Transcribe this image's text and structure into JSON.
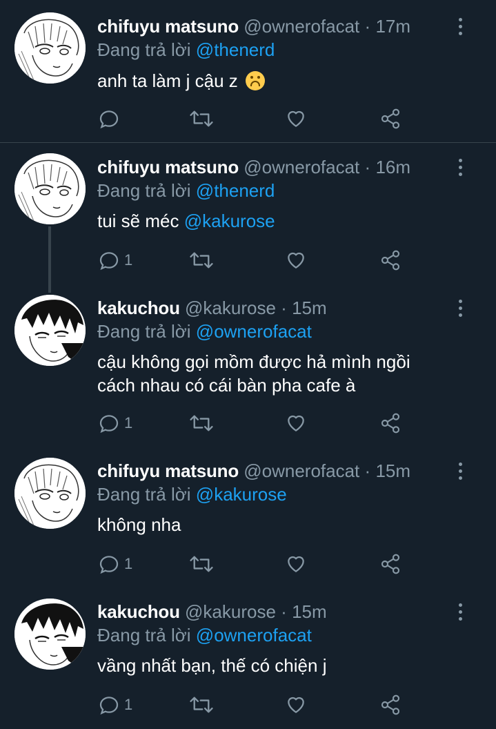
{
  "tweets": [
    {
      "name": "chifuyu matsuno",
      "handle": "@ownerofacat",
      "dot": "·",
      "time": "17m",
      "reply_prefix": "Đang trả lời",
      "reply_to": "@thenerd",
      "text": "anh ta làm j cậu z",
      "emoji": "upside-down-face-emoji",
      "replies": "",
      "avatar": "chifuyu-avatar"
    },
    {
      "name": "chifuyu matsuno",
      "handle": "@ownerofacat",
      "dot": "·",
      "time": "16m",
      "reply_prefix": "Đang trả lời",
      "reply_to": "@thenerd",
      "text": "tui sẽ méc",
      "text_mention": "@kakurose",
      "replies": "1",
      "avatar": "chifuyu-avatar"
    },
    {
      "name": "kakuchou",
      "handle": "@kakurose",
      "dot": "·",
      "time": "15m",
      "reply_prefix": "Đang trả lời",
      "reply_to": "@ownerofacat",
      "text_line1": "cậu không gọi mồm được hả mình ngồi",
      "text_line2": "cách nhau có cái bàn pha cafe à",
      "replies": "1",
      "avatar": "kakuchou-avatar"
    },
    {
      "name": "chifuyu matsuno",
      "handle": "@ownerofacat",
      "dot": "·",
      "time": "15m",
      "reply_prefix": "Đang trả lời",
      "reply_to": "@kakurose",
      "text": "không nha",
      "replies": "1",
      "avatar": "chifuyu-avatar"
    },
    {
      "name": "kakuchou",
      "handle": "@kakurose",
      "dot": "·",
      "time": "15m",
      "reply_prefix": "Đang trả lời",
      "reply_to": "@ownerofacat",
      "text": "vầng nhất bạn, thế có chiện j",
      "replies": "1",
      "avatar": "kakuchou-avatar"
    }
  ],
  "icons": {
    "reply": "reply-icon",
    "retweet": "retweet-icon",
    "like": "heart-icon",
    "share": "share-icon",
    "more": "more-icon"
  },
  "colors": {
    "background": "#15202b",
    "muted": "#8899a6",
    "link": "#1da1f2",
    "divider": "#38444d"
  }
}
